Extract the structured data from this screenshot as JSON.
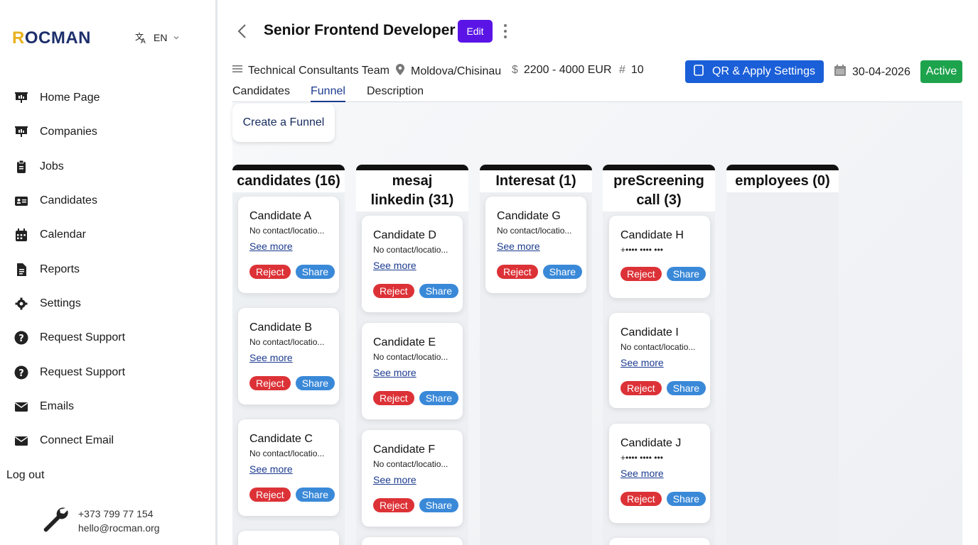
{
  "sidebar": {
    "logo": {
      "first_letter": "R",
      "rest": "OCMAN"
    },
    "language": "EN",
    "nav": [
      {
        "label": "Home Page",
        "icon": "presentation-icon"
      },
      {
        "label": "Companies",
        "icon": "presentation-icon"
      },
      {
        "label": "Jobs",
        "icon": "clipboard-icon"
      },
      {
        "label": "Candidates",
        "icon": "id-card-icon"
      },
      {
        "label": "Calendar",
        "icon": "calendar-icon"
      },
      {
        "label": "Reports",
        "icon": "document-icon"
      },
      {
        "label": "Settings",
        "icon": "gear-icon"
      },
      {
        "label": "Request Support",
        "icon": "question-icon"
      },
      {
        "label": "Request Support",
        "icon": "question-icon"
      },
      {
        "label": "Emails",
        "icon": "envelope-icon"
      },
      {
        "label": "Connect Email",
        "icon": "envelope-icon"
      }
    ],
    "logout": "Log out",
    "contact": {
      "phone": "+373 799 77 154",
      "email": "hello@rocman.org",
      "icon": "wrench-icon"
    }
  },
  "header": {
    "title": "Senior Frontend Developer",
    "edit_label": "Edit",
    "team": "Technical Consultants Team",
    "location": "Moldova/Chisinau",
    "salary": "2200 - 4000 EUR",
    "positions": "10",
    "qr_label": "QR & Apply Settings",
    "date": "30-04-2026",
    "status": "Active"
  },
  "tabs": [
    "Candidates",
    "Funnel",
    "Description"
  ],
  "active_tab": "Funnel",
  "funnel": {
    "create_label": "Create a Funnel",
    "see_more": "See more",
    "reject": "Reject",
    "share": "Share",
    "columns": [
      {
        "title": "candidates (16)",
        "cards": [
          {
            "name": "Candidate A",
            "info": "No contact/locatio..."
          },
          {
            "name": "Candidate B",
            "info": "No contact/locatio..."
          },
          {
            "name": "Candidate C",
            "info": "No contact/locatio..."
          }
        ]
      },
      {
        "title": "mesaj linkedin (31)",
        "cards": [
          {
            "name": "Candidate D",
            "info": "No contact/locatio..."
          },
          {
            "name": "Candidate E",
            "info": "No contact/locatio..."
          },
          {
            "name": "Candidate F",
            "info": "No contact/locatio..."
          }
        ]
      },
      {
        "title": "Interesat (1)",
        "cards": [
          {
            "name": "Candidate G",
            "info": "No contact/locatio..."
          }
        ]
      },
      {
        "title": "preScreening call (3)",
        "cards": [
          {
            "name": "Candidate H",
            "info": "+•••• •••• •••"
          },
          {
            "name": "Candidate I",
            "info": "No contact/locatio..."
          },
          {
            "name": "Candidate J",
            "info": "+•••• •••• •••"
          }
        ]
      },
      {
        "title": "employees (0)",
        "cards": []
      }
    ]
  }
}
